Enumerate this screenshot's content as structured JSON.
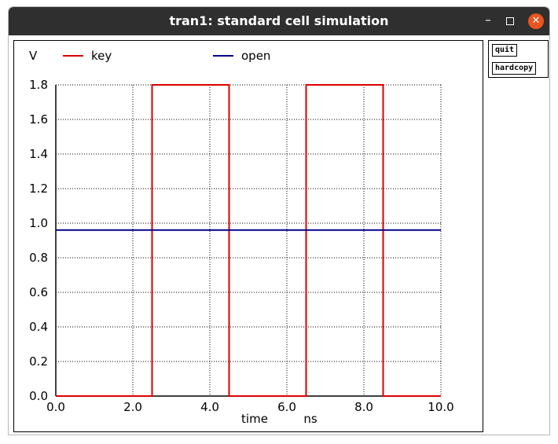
{
  "window": {
    "title": "tran1: standard cell simulation",
    "minimize_glyph": "–",
    "close_glyph": "✕"
  },
  "side_buttons": {
    "quit": "quit",
    "hardcopy": "hardcopy"
  },
  "chart_data": {
    "type": "line",
    "ylabel": "V",
    "xlabel": "time",
    "xunit": "ns",
    "xlim": [
      0,
      10
    ],
    "ylim": [
      0,
      1.8
    ],
    "xticks": [
      0,
      2,
      4,
      6,
      8,
      10
    ],
    "xtick_labels": [
      "0.0",
      "2.0",
      "4.0",
      "6.0",
      "8.0",
      "10.0"
    ],
    "yticks": [
      0,
      0.2,
      0.4,
      0.6,
      0.8,
      1.0,
      1.2,
      1.4,
      1.6,
      1.8
    ],
    "ytick_labels": [
      "0.0",
      "0.2",
      "0.4",
      "0.6",
      "0.8",
      "1.0",
      "1.2",
      "1.4",
      "1.6",
      "1.8"
    ],
    "grid": true,
    "legend_position": "top",
    "series": [
      {
        "name": "key",
        "color": "#dd0000",
        "x": [
          0,
          2.5,
          2.5,
          4.5,
          4.5,
          6.5,
          6.5,
          8.5,
          8.5,
          10
        ],
        "y": [
          0,
          0,
          1.8,
          1.8,
          0,
          0,
          1.8,
          1.8,
          0,
          0
        ]
      },
      {
        "name": "open",
        "color": "#000090",
        "x": [
          0,
          10
        ],
        "y": [
          0.96,
          0.96
        ]
      }
    ]
  }
}
